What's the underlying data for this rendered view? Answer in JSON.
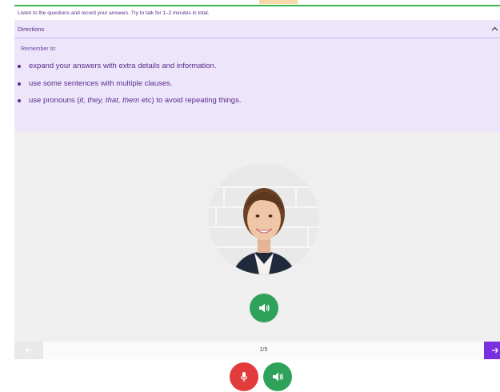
{
  "instructions": "Listen to the questions and record your answers. Try to talk for 1–2 minutes in total.",
  "directions": {
    "label": "Directions",
    "remember": "Remember to:",
    "tips": [
      "expand your answers with extra details and information.",
      "use some sentences with multiple clauses.",
      "use pronouns (it, they, that, them etc) to avoid repeating things."
    ],
    "tip3_parts": {
      "before": "use pronouns (",
      "italic": "it, they, that, them",
      "after": " etc) to avoid repeating things."
    }
  },
  "navigation": {
    "page": "1/5"
  },
  "icons": {
    "collapse": "chevron-up-icon",
    "speaker": "speaker-icon",
    "mic": "microphone-icon",
    "prev": "arrow-left-icon",
    "next": "arrow-right-icon"
  },
  "colors": {
    "accent_purple": "#7a2fe0",
    "panel_purple": "#ede6fb",
    "text_purple": "#5a2a8a",
    "speaker_green": "#2ea25a",
    "record_red": "#e23b3b",
    "top_green": "#3bb54a"
  }
}
